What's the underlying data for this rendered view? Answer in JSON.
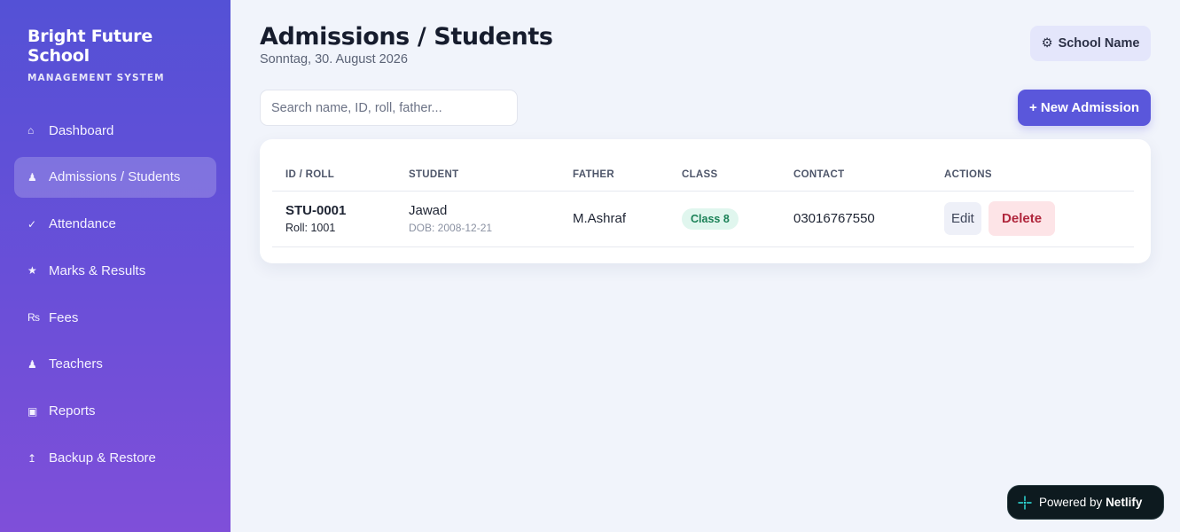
{
  "brand": {
    "name": "Bright Future School",
    "subtitle": "MANAGEMENT SYSTEM"
  },
  "sidebar": {
    "items": [
      {
        "icon": "⌂",
        "icon_name": "home-icon",
        "label": "Dashboard",
        "active": false
      },
      {
        "icon": "♟",
        "icon_name": "student-icon",
        "label": "Admissions / Students",
        "active": true
      },
      {
        "icon": "✓",
        "icon_name": "check-icon",
        "label": "Attendance",
        "active": false
      },
      {
        "icon": "★",
        "icon_name": "star-icon",
        "label": "Marks & Results",
        "active": false
      },
      {
        "icon": "₨",
        "icon_name": "rupee-icon",
        "label": "Fees",
        "active": false
      },
      {
        "icon": "♟",
        "icon_name": "teacher-icon",
        "label": "Teachers",
        "active": false
      },
      {
        "icon": "▣",
        "icon_name": "reports-icon",
        "label": "Reports",
        "active": false
      },
      {
        "icon": "↥",
        "icon_name": "backup-icon",
        "label": "Backup & Restore",
        "active": false
      }
    ]
  },
  "header": {
    "title": "Admissions / Students",
    "date": "Sonntag, 30. August 2026",
    "school_button": "School Name",
    "school_icon": "⚙"
  },
  "search": {
    "placeholder": "Search name, ID, roll, father...",
    "value": ""
  },
  "new_admission_label": "+ New Admission",
  "table": {
    "columns": [
      "ID / ROLL",
      "STUDENT",
      "FATHER",
      "CLASS",
      "CONTACT",
      "ACTIONS"
    ],
    "rows": [
      {
        "id": "STU-0001",
        "roll": "Roll: 1001",
        "student": "Jawad",
        "dob": "DOB: 2008-12-21",
        "father": "M.Ashraf",
        "class": "Class 8",
        "contact": "03016767550",
        "edit_label": "Edit",
        "delete_label": "Delete"
      }
    ]
  },
  "footer_badge": {
    "prefix": "Powered by",
    "brand": "Netlify"
  },
  "colors": {
    "accent": "#5a57db",
    "sidebar_top": "#5451d6",
    "sidebar_bottom": "#7f4fd9",
    "badge_bg": "#e0f6ee",
    "badge_text": "#1b8157",
    "delete_bg": "#fde4e7",
    "delete_text": "#b0263c"
  }
}
